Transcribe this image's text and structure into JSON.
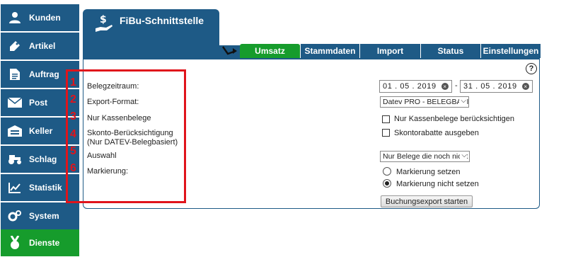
{
  "sidebar": {
    "items": [
      {
        "label": "Kunden",
        "icon": "user-icon"
      },
      {
        "label": "Artikel",
        "icon": "tag-icon"
      },
      {
        "label": "Auftrag",
        "icon": "document-icon"
      },
      {
        "label": "Post",
        "icon": "envelope-icon"
      },
      {
        "label": "Keller",
        "icon": "warehouse-icon"
      },
      {
        "label": "Schlag",
        "icon": "tractor-icon"
      },
      {
        "label": "Statistik",
        "icon": "chart-icon"
      },
      {
        "label": "System",
        "icon": "gears-icon"
      },
      {
        "label": "Dienste",
        "icon": "medal-icon"
      }
    ],
    "active": "Dienste"
  },
  "header": {
    "title": "FiBu-Schnittstelle"
  },
  "tabs": [
    "Umsatz",
    "Stammdaten",
    "Import",
    "Status",
    "Einstellungen"
  ],
  "active_tab": "Umsatz",
  "help": "?",
  "numbers": [
    "1",
    "2",
    "3",
    "4",
    "5",
    "6"
  ],
  "form": {
    "belegzeitraum_label": "Belegzeitraum:",
    "date_from": "01 . 05 . 2019",
    "date_sep": "-",
    "date_to": "31 . 05 . 2019",
    "export_format_label": "Export-Format:",
    "export_format_value": "Datev PRO - BELEGBASIERT",
    "kassenbelege_label": "Nur Kassenbelege",
    "kassenbelege_option": "Nur Kassenbelege berücksichtigen",
    "skonto_label_1": "Skonto-Berücksichtigung",
    "skonto_label_2": "(Nur DATEV-Belegbasiert)",
    "skonto_option": "Skontorabatte ausgeben",
    "auswahl_label": "Auswahl",
    "auswahl_value": "Nur Belege die noch nicht exportiert",
    "markierung_label": "Markierung:",
    "markierung_option_1": "Markierung setzen",
    "markierung_option_2": "Markierung nicht setzen",
    "markierung_selected": "Markierung nicht setzen",
    "submit": "Buchungsexport starten"
  },
  "colors": {
    "nav_blue": "#1e5a86",
    "active_green": "#169c2c",
    "annotation_red": "#e0141b"
  }
}
